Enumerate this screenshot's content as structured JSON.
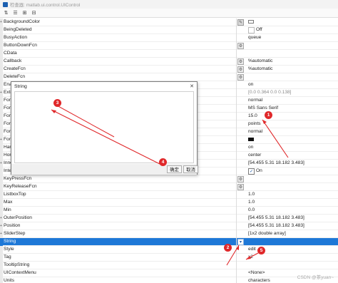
{
  "window": {
    "title": "检查器: matlab.ui.control.UIControl"
  },
  "toolbar": {
    "buttons": [
      {
        "icon": "sort-icon",
        "glyph": "⇅"
      },
      {
        "icon": "categorize-icon",
        "glyph": "☰"
      },
      {
        "icon": "expand-all-icon",
        "glyph": "⊞"
      },
      {
        "icon": "collapse-all-icon",
        "glyph": "⊟"
      }
    ]
  },
  "properties": [
    {
      "name": "BackgroundColor",
      "value": "",
      "expander": "+",
      "control": "pencil",
      "swatch": "white"
    },
    {
      "name": "BeingDeleted",
      "value": "Off",
      "control": "checkbox-off"
    },
    {
      "name": "BusyAction",
      "value": "queue"
    },
    {
      "name": "ButtonDownFcn",
      "value": "",
      "control": "wrench"
    },
    {
      "name": "CData",
      "value": ""
    },
    {
      "name": "Callback",
      "value": "%automatic",
      "control": "wrench"
    },
    {
      "name": "CreateFcn",
      "value": "%automatic",
      "control": "wrench"
    },
    {
      "name": "DeleteFcn",
      "value": "",
      "control": "wrench"
    },
    {
      "name": "Enable",
      "value": "on"
    },
    {
      "name": "Extent",
      "value": "[0.0 0.364 0.0 0.138]",
      "expander": "+",
      "dim": true
    },
    {
      "name": "FontAngle",
      "value": "normal"
    },
    {
      "name": "FontName",
      "value": "MS Sans Serif"
    },
    {
      "name": "FontSize",
      "value": "15.0"
    },
    {
      "name": "FontUnits",
      "value": "points"
    },
    {
      "name": "FontWeight",
      "value": "normal"
    },
    {
      "name": "ForegroundC",
      "value": "",
      "expander": "+",
      "swatch": "black"
    },
    {
      "name": "HandleVisibil",
      "value": "on"
    },
    {
      "name": "HorizontalAl",
      "value": "center"
    },
    {
      "name": "InnerPosition",
      "value": "[54.455 5.31 18.182 3.483]",
      "expander": "+"
    },
    {
      "name": "Interruptible",
      "value": "On",
      "control": "checkbox-on"
    },
    {
      "name": "KeyPressFcn",
      "value": "",
      "control": "wrench"
    },
    {
      "name": "KeyReleaseFcn",
      "value": "",
      "control": "wrench"
    },
    {
      "name": "ListboxTop",
      "value": "1.0"
    },
    {
      "name": "Max",
      "value": "1.0"
    },
    {
      "name": "Min",
      "value": "0.0"
    },
    {
      "name": "OuterPosition",
      "value": "[54.455 5.31 18.182 3.483]",
      "expander": "+"
    },
    {
      "name": "Position",
      "value": "[54.455 5.31 18.182 3.483]",
      "expander": "+"
    },
    {
      "name": "SliderStep",
      "value": "[1x2  double array]",
      "expander": "+"
    },
    {
      "name": "String",
      "value": "",
      "control": "dropdown",
      "selected": true
    },
    {
      "name": "Style",
      "value": "edit"
    },
    {
      "name": "Tag",
      "value": "x2"
    },
    {
      "name": "TooltipString",
      "value": ""
    },
    {
      "name": "UIContextMenu",
      "value": "<None>"
    },
    {
      "name": "Units",
      "value": "characters"
    }
  ],
  "dialog": {
    "title": "String",
    "close_glyph": "✕",
    "text": "",
    "ok_label": "确定",
    "cancel_label": "取消"
  },
  "annotations": {
    "color": "#e0282a",
    "markers": [
      "1",
      "2",
      "3",
      "4",
      "5"
    ]
  },
  "watermark": "CSDN @茶yuan~"
}
